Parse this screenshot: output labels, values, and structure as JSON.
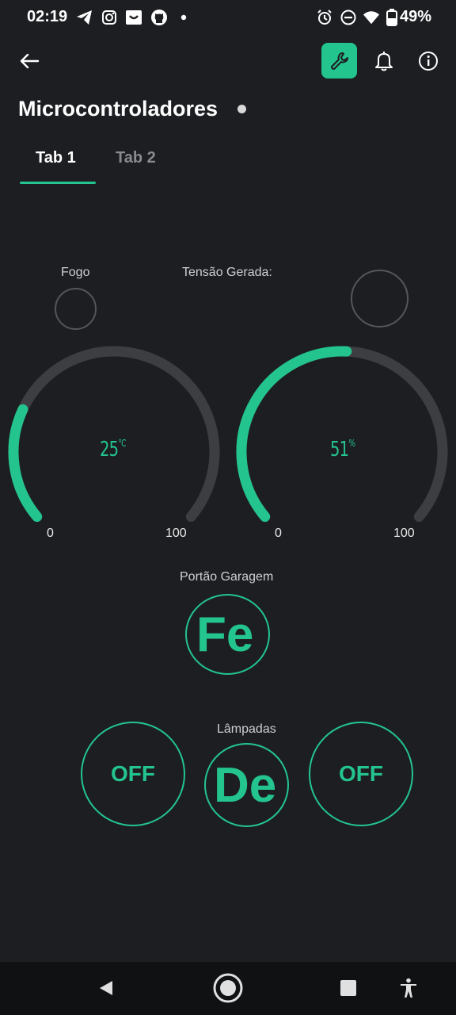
{
  "status_bar": {
    "time": "02:19",
    "battery": "49%",
    "left_icons": [
      "telegram-icon",
      "instagram-icon",
      "shop-icon",
      "github-icon",
      "dot-icon"
    ],
    "right_icons": [
      "alarm-icon",
      "dnd-icon",
      "wifi-icon",
      "battery-icon"
    ]
  },
  "header": {
    "title": "Microcontroladores",
    "accent": "#23c48e"
  },
  "tabs": [
    {
      "label": "Tab 1",
      "active": true
    },
    {
      "label": "Tab 2",
      "active": false
    }
  ],
  "widgets": {
    "fogo": {
      "label": "Fogo"
    },
    "tensao": {
      "label": "Tensão Gerada:"
    },
    "gauge_temp": {
      "value": "25",
      "unit": "°C",
      "min": "0",
      "max": "100",
      "level": 0.25
    },
    "gauge_percent": {
      "value": "51",
      "unit": "%",
      "min": "0",
      "max": "100",
      "level": 0.51
    },
    "portao": {
      "label": "Portão Garagem",
      "button": "Fe"
    },
    "lampadas": {
      "label": "Lâmpadas",
      "left_button": "OFF",
      "center_button": "De",
      "right_button": "OFF"
    }
  },
  "colors": {
    "background": "#1d1e22",
    "accent": "#23c48e",
    "track": "#3d3e42"
  }
}
